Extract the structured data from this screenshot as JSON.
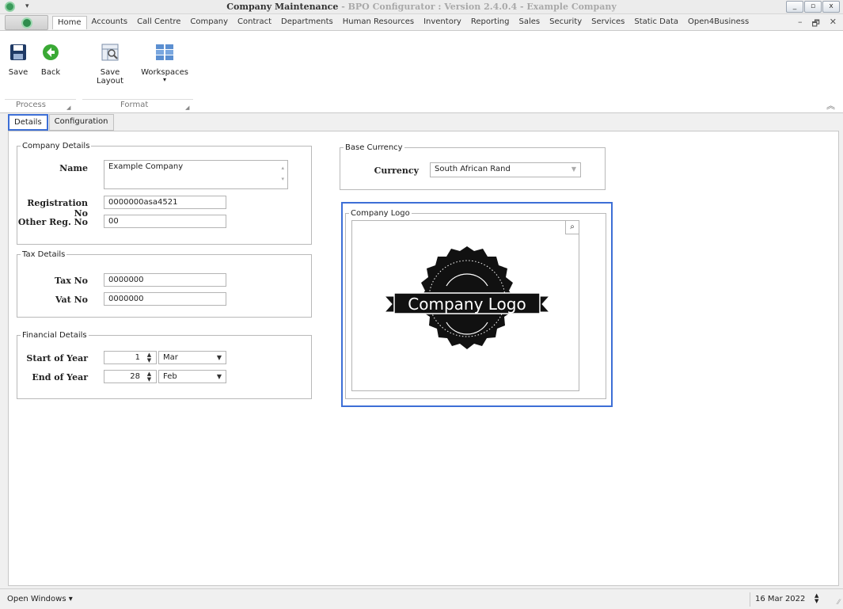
{
  "window": {
    "title_main": "Company Maintenance",
    "title_rest": " - BPO Configurator : Version 2.4.0.4 - Example Company",
    "buttons": [
      "_",
      "▫",
      "x"
    ]
  },
  "menu": {
    "tabs": [
      "Home",
      "Accounts",
      "Call Centre",
      "Company",
      "Contract",
      "Departments",
      "Human Resources",
      "Inventory",
      "Reporting",
      "Sales",
      "Security",
      "Services",
      "Static Data",
      "Open4Business"
    ],
    "mdi": [
      "–",
      "🗗",
      "✕"
    ]
  },
  "ribbon": {
    "save": "Save",
    "back": "Back",
    "save_layout": "Save Layout",
    "workspaces": "Workspaces",
    "group_process": "Process",
    "group_format": "Format"
  },
  "doc_tabs": {
    "details": "Details",
    "configuration": "Configuration"
  },
  "company_details": {
    "legend": "Company Details",
    "name_label": "Name",
    "name_value": "Example Company",
    "reg_label": "Registration No",
    "reg_value": "0000000asa4521",
    "other_label": "Other Reg. No",
    "other_value": "00"
  },
  "tax_details": {
    "legend": "Tax Details",
    "tax_label": "Tax No",
    "tax_value": "0000000",
    "vat_label": "Vat No",
    "vat_value": "0000000"
  },
  "financial_details": {
    "legend": "Financial Details",
    "start_label": "Start of Year",
    "start_day": "1",
    "start_month": "Mar",
    "end_label": "End of Year",
    "end_day": "28",
    "end_month": "Feb"
  },
  "base_currency": {
    "legend": "Base Currency",
    "currency_label": "Currency",
    "currency_value": "South African Rand"
  },
  "company_logo": {
    "legend": "Company Logo",
    "logo_text": "Company Logo"
  },
  "status": {
    "open_windows": "Open Windows ▾",
    "date": "16 Mar 2022"
  },
  "colors": {
    "highlight": "#3d6fd6",
    "save_icon": "#1f3a66",
    "back_icon": "#3aa935"
  }
}
